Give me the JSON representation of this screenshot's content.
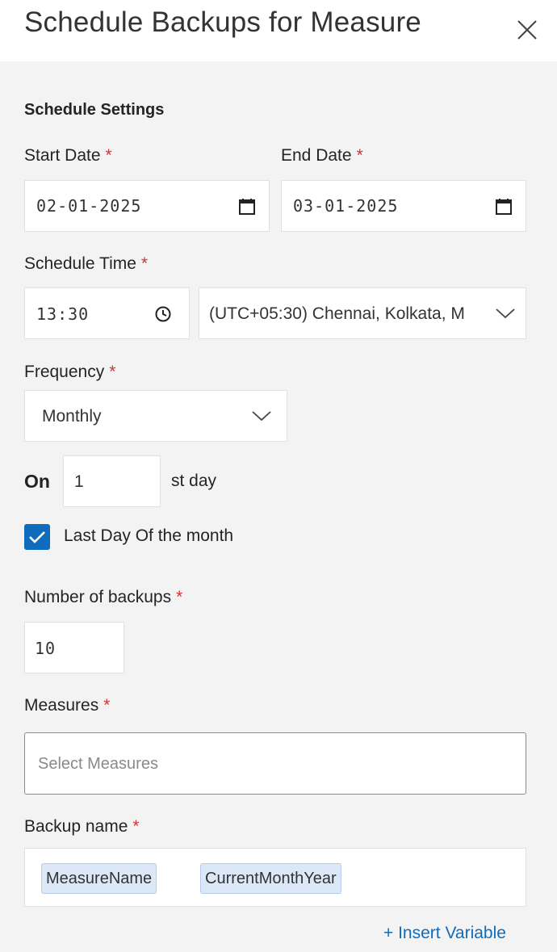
{
  "dialog": {
    "title": "Schedule Backups for Measure"
  },
  "section": {
    "title": "Schedule Settings"
  },
  "start_date": {
    "label": "Start Date",
    "required": "*",
    "value": "02-01-2025"
  },
  "end_date": {
    "label": "End Date",
    "required": "*",
    "value": "03-01-2025"
  },
  "schedule_time": {
    "label": "Schedule Time",
    "required": "*",
    "value": "13:30",
    "timezone": "(UTC+05:30) Chennai, Kolkata, M"
  },
  "frequency": {
    "label": "Frequency",
    "required": "*",
    "value": "Monthly"
  },
  "on_day": {
    "label": "On",
    "value": "1",
    "suffix": "st day"
  },
  "last_day": {
    "label": "Last Day Of the month",
    "checked": true
  },
  "num_backups": {
    "label": "Number of backups",
    "required": "*",
    "value": "10"
  },
  "measures": {
    "label": "Measures",
    "required": "*",
    "placeholder": "Select Measures"
  },
  "backup_name": {
    "label": "Backup name",
    "required": "*",
    "chips": [
      "MeasureName",
      "CurrentMonthYear"
    ]
  },
  "insert_variable": {
    "label": "+ Insert Variable"
  },
  "colors": {
    "accent": "#0f6cbd",
    "required": "#d13438",
    "chip_bg": "#dce8f8"
  }
}
